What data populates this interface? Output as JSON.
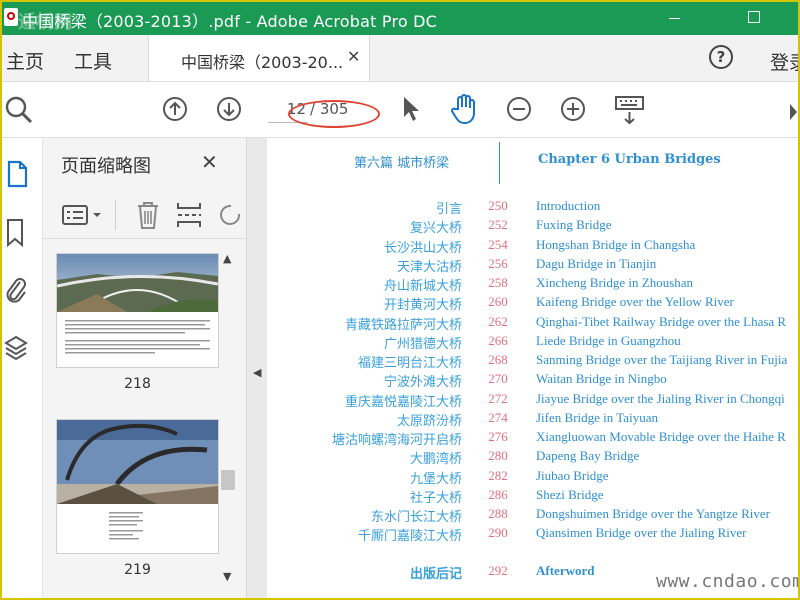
{
  "window": {
    "title": "中国桥梁（2003-2013）.pdf - Adobe Acrobat Pro DC",
    "overlay_watermark": "适桥网"
  },
  "tabs": {
    "home": "主页",
    "tools": "工具",
    "document": "中国桥梁（2003-20...",
    "document_close": "✕",
    "login": "登录"
  },
  "toolbar": {
    "current_page": "12",
    "total_pages": "/ 305",
    "icons": [
      "zoom-icon",
      "page-up-icon",
      "page-down-icon",
      "select-arrow-icon",
      "hand-icon",
      "zoom-out-icon",
      "zoom-in-icon",
      "keyboard-icon"
    ]
  },
  "panel": {
    "title": "页面缩略图",
    "close": "✕",
    "thumbnails": [
      {
        "page_label": "218"
      },
      {
        "page_label": "219"
      }
    ]
  },
  "document": {
    "chapter_cn": "第六篇  城市桥梁",
    "chapter_en": "Chapter 6   Urban Bridges",
    "toc": [
      {
        "cn": "引言",
        "page": "250",
        "en": "Introduction"
      },
      {
        "cn": "复兴大桥",
        "page": "252",
        "en": "Fuxing Bridge"
      },
      {
        "cn": "长沙洪山大桥",
        "page": "254",
        "en": "Hongshan Bridge in Changsha"
      },
      {
        "cn": "天津大沽桥",
        "page": "256",
        "en": "Dagu Bridge in Tianjin"
      },
      {
        "cn": "舟山新城大桥",
        "page": "258",
        "en": "Xincheng Bridge in Zhoushan"
      },
      {
        "cn": "开封黄河大桥",
        "page": "260",
        "en": "Kaifeng Bridge over the Yellow River"
      },
      {
        "cn": "青藏铁路拉萨河大桥",
        "page": "262",
        "en": "Qinghai-Tibet Railway Bridge over the Lhasa R"
      },
      {
        "cn": "广州猎德大桥",
        "page": "266",
        "en": "Liede Bridge in Guangzhou"
      },
      {
        "cn": "福建三明台江大桥",
        "page": "268",
        "en": "Sanming Bridge over the Taijiang River in Fujia"
      },
      {
        "cn": "宁波外滩大桥",
        "page": "270",
        "en": "Waitan Bridge in Ningbo"
      },
      {
        "cn": "重庆嘉悦嘉陵江大桥",
        "page": "272",
        "en": "Jiayue Bridge over the Jialing River in Chongqi"
      },
      {
        "cn": "太原跻汾桥",
        "page": "274",
        "en": "Jifen Bridge in Taiyuan"
      },
      {
        "cn": "塘沽响螺湾海河开启桥",
        "page": "276",
        "en": "Xiangluowan Movable Bridge over the Haihe R"
      },
      {
        "cn": "大鹏湾桥",
        "page": "280",
        "en": "Dapeng Bay Bridge"
      },
      {
        "cn": "九堡大桥",
        "page": "282",
        "en": "Jiubao Bridge"
      },
      {
        "cn": "社子大桥",
        "page": "286",
        "en": "Shezi Bridge"
      },
      {
        "cn": "东水门长江大桥",
        "page": "288",
        "en": "Dongshuimen Bridge over the Yangtze River"
      },
      {
        "cn": "千厮门嘉陵江大桥",
        "page": "290",
        "en": "Qiansimen Bridge over the Jialing River"
      }
    ],
    "afterword": {
      "cn": "出版后记",
      "page": "292",
      "en": "Afterword"
    }
  },
  "corner_watermark": "www.cndao.com",
  "colors": {
    "titlebar": "#1b9a55",
    "accent_blue": "#2f8fd0",
    "page_number_pink": "#e07080",
    "annotation_red": "#d43"
  }
}
